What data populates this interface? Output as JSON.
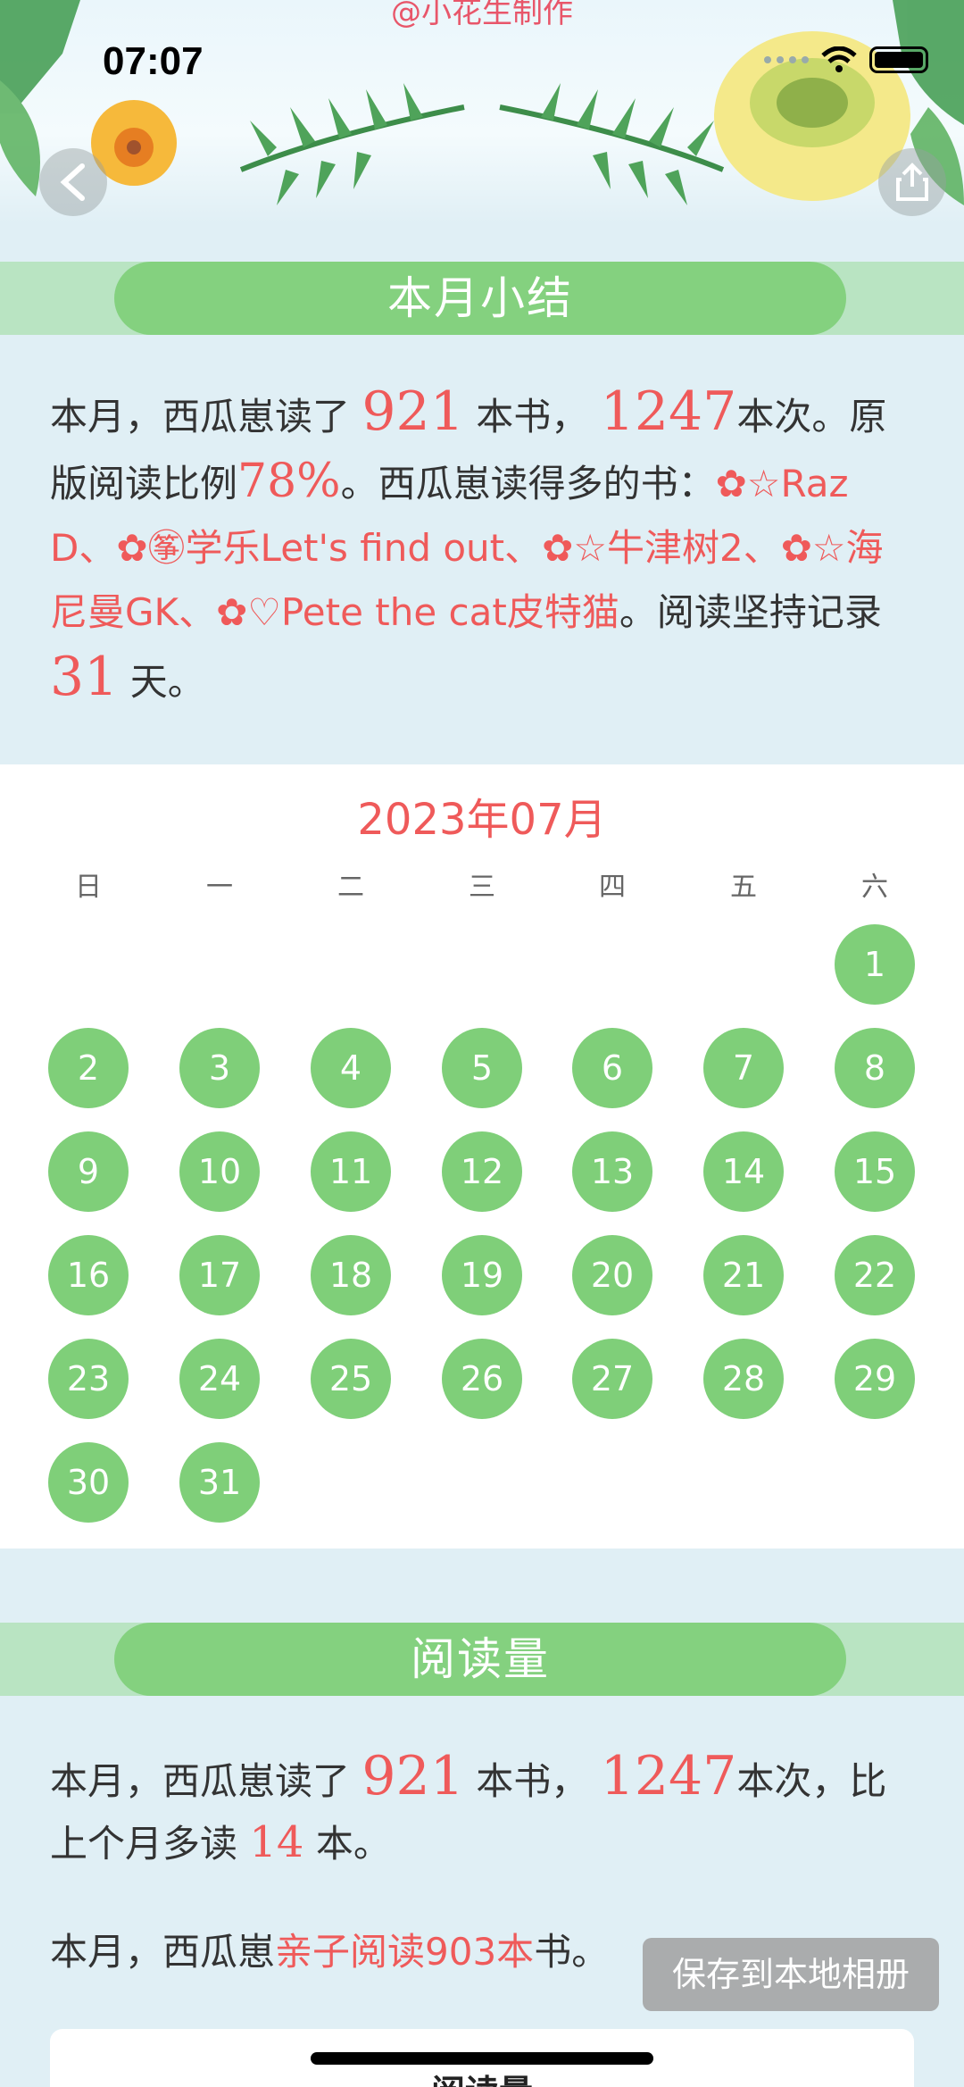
{
  "banner": {
    "credit": "@小花生制作",
    "status_time": "07:07"
  },
  "summary": {
    "title": "本月小结",
    "p1": "本月，西瓜崽读了",
    "books": "921",
    "p2": "本书，",
    "times": "1247",
    "p3": "本次。原版阅读比例",
    "ratio": "78%",
    "p4": "。西瓜崽读得多的书：",
    "top_books": "✿☆Raz D、✿㉇学乐Let's find out、✿☆牛津树2、✿☆海尼曼GK、✿♡Pete the cat皮特猫",
    "p5": "。阅读坚持记录",
    "streak": "31",
    "p6": "天。"
  },
  "calendar": {
    "title": "2023年07月",
    "weekdays": [
      "日",
      "一",
      "二",
      "三",
      "四",
      "五",
      "六"
    ],
    "first_weekday_index": 6,
    "days_in_month": 31,
    "read_days": [
      1,
      2,
      3,
      4,
      5,
      6,
      7,
      8,
      9,
      10,
      11,
      12,
      13,
      14,
      15,
      16,
      17,
      18,
      19,
      20,
      21,
      22,
      23,
      24,
      25,
      26,
      27,
      28,
      29,
      30,
      31
    ],
    "read_color": "#7fcf79"
  },
  "reading": {
    "title": "阅读量",
    "p1": "本月，西瓜崽读了",
    "books": "921",
    "p2": "本书，",
    "times": "1247",
    "p3": "本次，比上个月多读",
    "more": "14",
    "p4": "本。",
    "q1": "本月，西瓜崽",
    "parent_reading": "亲子阅读903本",
    "q2": "书。"
  },
  "save_button": "保存到本地相册",
  "bottom_card_title": "阅读量",
  "colors": {
    "accent_red": "#ef5a5a",
    "green_pill": "#84d17f",
    "green_bar": "#b9e4c2",
    "page_bg": "#e0eff5"
  }
}
